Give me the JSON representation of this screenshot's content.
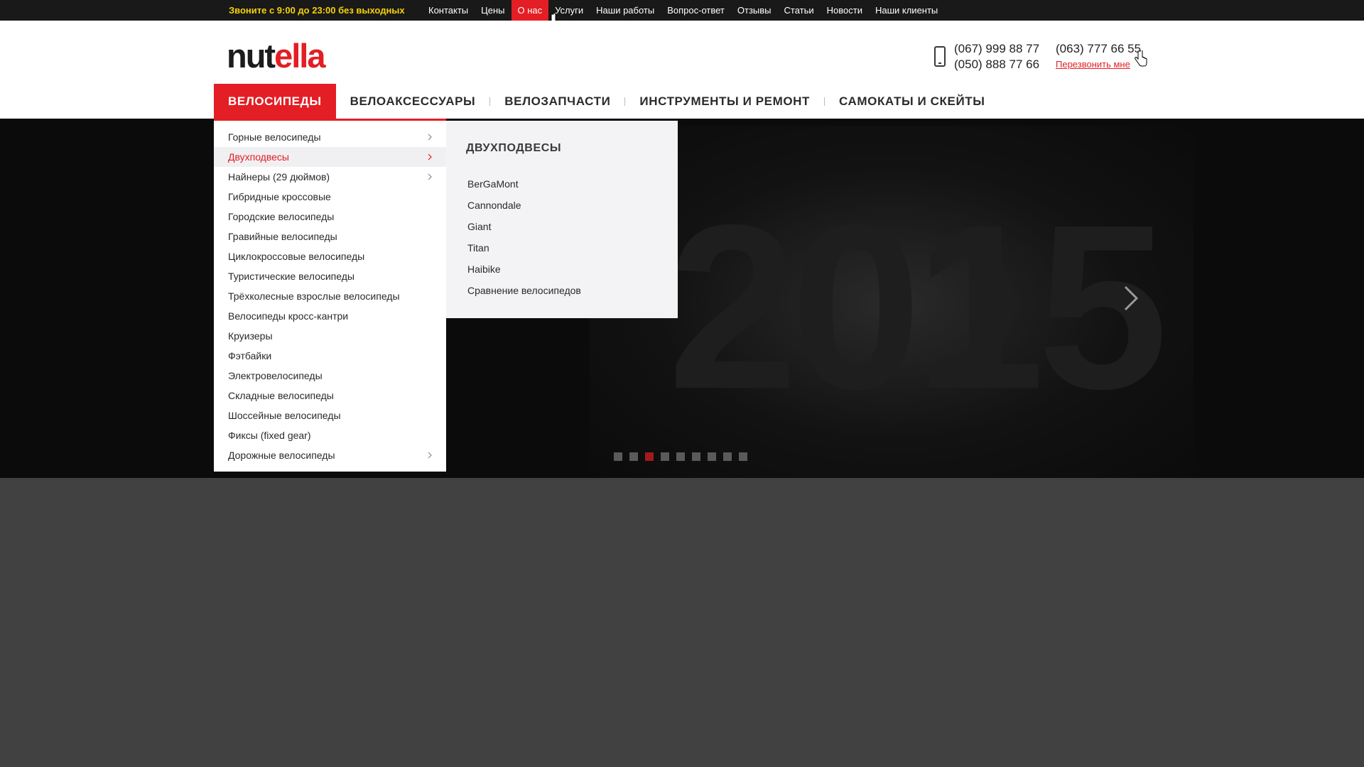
{
  "topbar": {
    "hours": "Звоните с 9:00 до 23:00 без выходных",
    "links": [
      {
        "label": "Контакты",
        "active": false
      },
      {
        "label": "Цены",
        "active": false
      },
      {
        "label": "О нас",
        "active": true
      },
      {
        "label": "Услуги",
        "active": false
      },
      {
        "label": "Наши работы",
        "active": false
      },
      {
        "label": "Вопрос-ответ",
        "active": false
      },
      {
        "label": "Отзывы",
        "active": false
      },
      {
        "label": "Статьи",
        "active": false
      },
      {
        "label": "Новости",
        "active": false
      },
      {
        "label": "Наши клиенты",
        "active": false
      }
    ]
  },
  "header": {
    "logo": {
      "part1": "nut",
      "part2": "ella"
    },
    "phones": [
      "(067) 999 88 77",
      "(050) 888 77 66",
      "(063) 777 66 55"
    ],
    "callback": "Перезвонить мне"
  },
  "mainnav": {
    "items": [
      {
        "label": "ВЕЛОСИПЕДЫ",
        "active": true
      },
      {
        "label": "ВЕЛОАКСЕССУАРЫ",
        "active": false
      },
      {
        "label": "ВЕЛОЗАПЧАСТИ",
        "active": false
      },
      {
        "label": "ИНСТРУМЕНТЫ И РЕМОНТ",
        "active": false
      },
      {
        "label": "САМОКАТЫ И СКЕЙТЫ",
        "active": false
      }
    ]
  },
  "dropdown": {
    "items": [
      {
        "label": "Горные велосипеды",
        "arrow": true,
        "active": false
      },
      {
        "label": "Двухподвесы",
        "arrow": true,
        "active": true
      },
      {
        "label": "Найнеры (29 дюймов)",
        "arrow": true,
        "active": false
      },
      {
        "label": "Гибридные кроссовые",
        "arrow": false,
        "active": false
      },
      {
        "label": "Городские велосипеды",
        "arrow": false,
        "active": false
      },
      {
        "label": "Гравийные велосипеды",
        "arrow": false,
        "active": false
      },
      {
        "label": "Циклокроссовые велосипеды",
        "arrow": false,
        "active": false
      },
      {
        "label": "Туристические велосипеды",
        "arrow": false,
        "active": false
      },
      {
        "label": "Трёхколесные взрослые велосипеды",
        "arrow": false,
        "active": false
      },
      {
        "label": "Велосипеды кросс-кантри",
        "arrow": false,
        "active": false
      },
      {
        "label": "Круизеры",
        "arrow": false,
        "active": false
      },
      {
        "label": "Фэтбайки",
        "arrow": false,
        "active": false
      },
      {
        "label": "Электровелосипеды",
        "arrow": false,
        "active": false
      },
      {
        "label": "Складные велосипеды",
        "arrow": false,
        "active": false
      },
      {
        "label": "Шоссейные велосипеды",
        "arrow": false,
        "active": false
      },
      {
        "label": "Фиксы (fixed gear)",
        "arrow": false,
        "active": false
      },
      {
        "label": "Дорожные велосипеды",
        "arrow": true,
        "active": false
      }
    ]
  },
  "subpanel": {
    "title": "ДВУХПОДВЕСЫ",
    "links": [
      "BerGaMont",
      "Cannondale",
      "Giant",
      "Titan",
      "Haibike",
      "Сравнение велосипедов"
    ]
  },
  "hero": {
    "background_text": "2015",
    "slides_count": 9,
    "active_slide": 3
  },
  "colors": {
    "accent": "#e31e24",
    "topbar_bg": "#191919",
    "hours_text": "#f5d10b",
    "page_bg": "#414141"
  }
}
